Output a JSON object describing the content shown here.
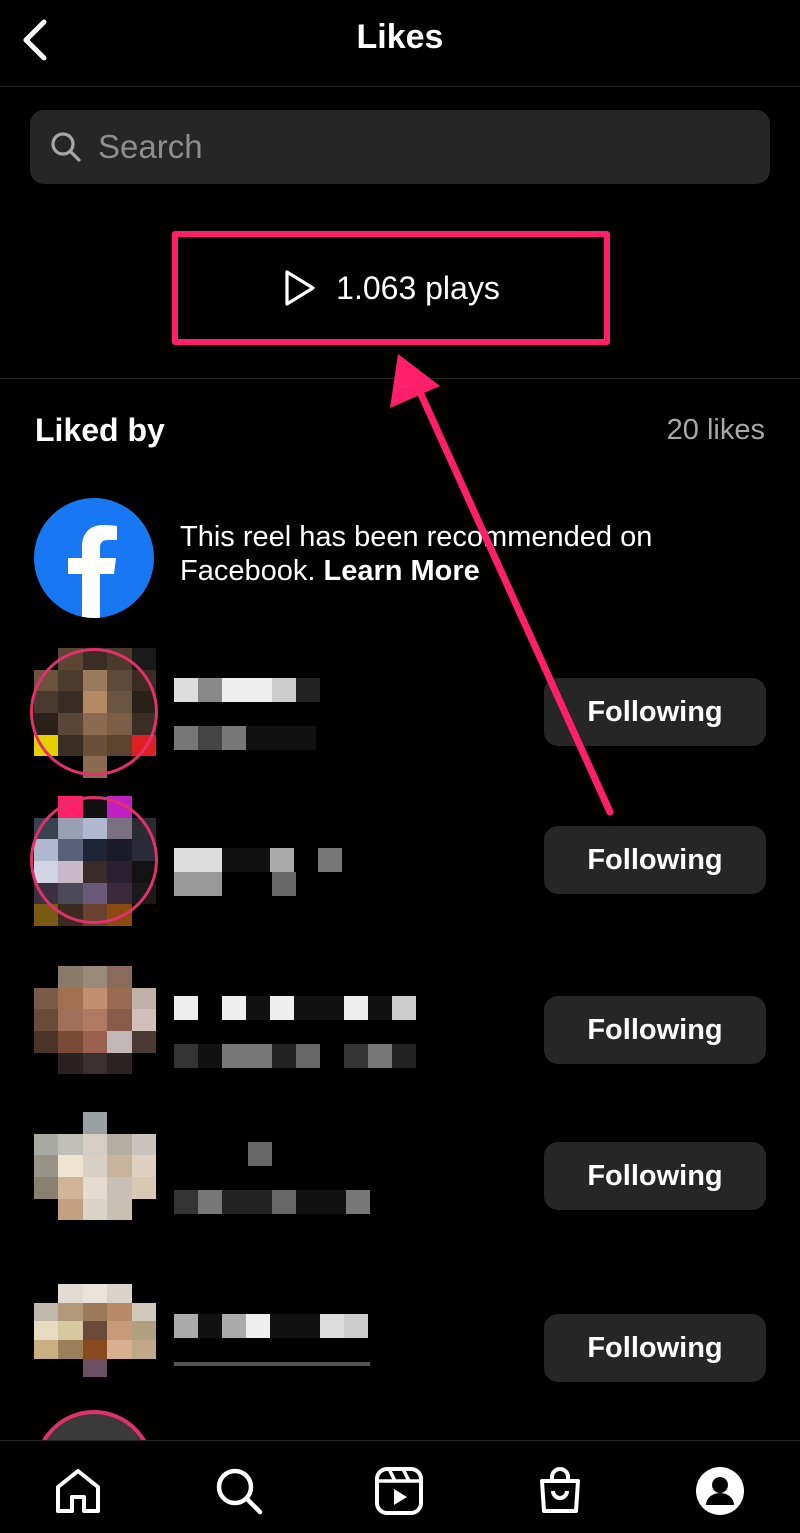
{
  "header": {
    "title": "Likes"
  },
  "search": {
    "placeholder": "Search"
  },
  "plays": {
    "label": "1.063 plays"
  },
  "liked_by": {
    "heading": "Liked by",
    "count": "20 likes"
  },
  "facebook_notice": {
    "text": "This reel has been recommended on Facebook.",
    "link": "Learn More"
  },
  "users": [
    {
      "button": "Following"
    },
    {
      "button": "Following"
    },
    {
      "button": "Following"
    },
    {
      "button": "Following"
    },
    {
      "button": "Following"
    }
  ],
  "colors": {
    "accent": "#ff1f6b",
    "background": "#000000",
    "button_bg": "#262626",
    "facebook_blue": "#1877f2"
  },
  "bottom_nav": {
    "items": [
      "home-icon",
      "search-icon",
      "reels-icon",
      "shop-icon",
      "profile-icon"
    ]
  }
}
